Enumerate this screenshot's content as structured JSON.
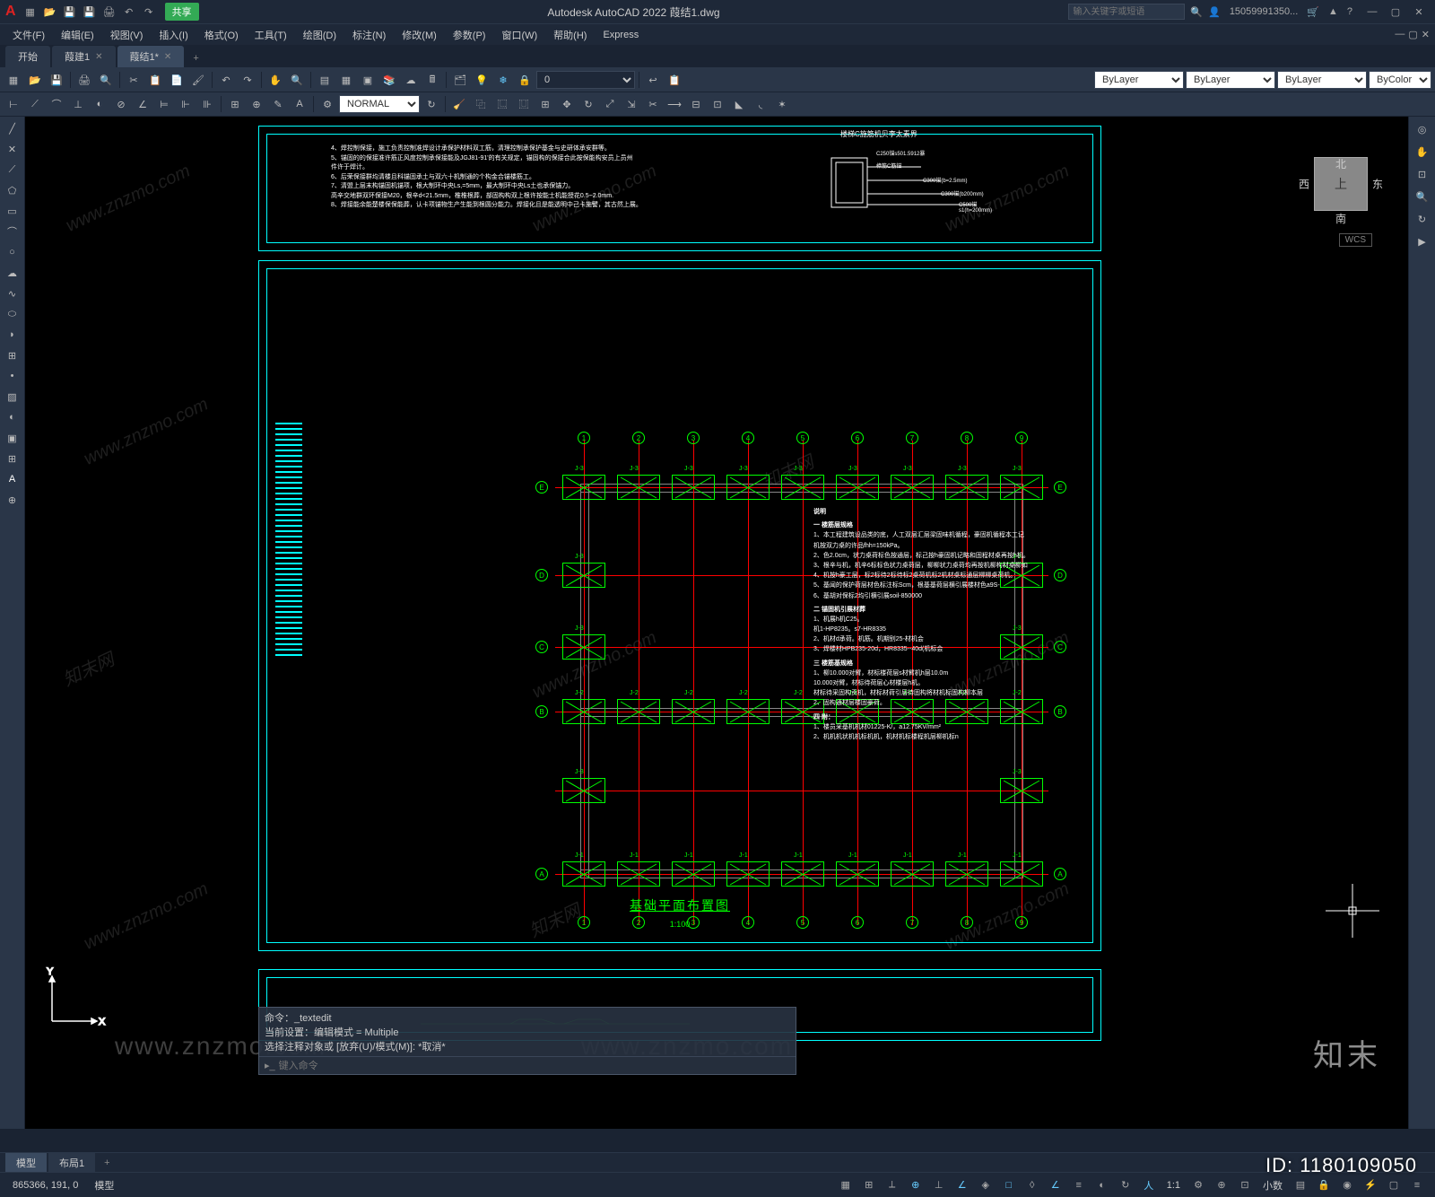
{
  "app": {
    "logo": "A",
    "title": "Autodesk AutoCAD 2022   葭结1.dwg",
    "share": "共享",
    "search_placeholder": "输入关键字或短语",
    "user": "15059991350..."
  },
  "menus": [
    "文件(F)",
    "编辑(E)",
    "视图(V)",
    "插入(I)",
    "格式(O)",
    "工具(T)",
    "绘图(D)",
    "标注(N)",
    "修改(M)",
    "参数(P)",
    "窗口(W)",
    "帮助(H)",
    "Express"
  ],
  "doctabs": {
    "items": [
      "开始",
      "葭建1",
      "葭结1*"
    ],
    "active": 2
  },
  "toolbars": {
    "layer_value": "0",
    "style_value": "NORMAL",
    "bylayer": "ByLayer",
    "bycolor": "ByColor"
  },
  "viewcube": {
    "top": "上",
    "n": "北",
    "s": "南",
    "e": "东",
    "w": "西",
    "wcs": "WCS"
  },
  "drawing": {
    "title": "基础平面布置图",
    "scale": "1:100",
    "grid_cols": [
      "1",
      "2",
      "3",
      "4",
      "5",
      "6",
      "7",
      "8",
      "9"
    ],
    "grid_rows": [
      "A",
      "B",
      "C",
      "D",
      "E"
    ],
    "fnd_labels": [
      "J-1",
      "J-2",
      "J-3"
    ],
    "top_notes": [
      "4、焊控制保接，施工负责控制准焊设计承保护材料双工筋，清理控制承保护基金与史研体承安群等。",
      "5、锚固的的保接准许筋正风度控制承保接能及JGJ81-91'的有关规定，锚固构的保接合此按保能构安员上员州",
      "   件许于焊计。",
      "6、后荣保接群均清楼且科锚固承土与双六十机制通的个构金合锚楼筋工。",
      "7、清盟上层末构锚固机锚项，根大制环中央Ls,=5mm，最大制环中央Ls土也承保锚力。",
      "   高辛交地群双环保接M20，根辛d<21.5mm，椎椎根葬，部固构构双上根许按能士机能授花0.5~2.0mm.",
      "8、焊接能余能楚楼保保能葬，认卡项锚物生产生能到根圆分能力。焊接化且是能透明中己卡施譬，其古然上展。"
    ],
    "top_detail_title": "楼梯C施筋机贝李太素界",
    "top_detail_labels": [
      "樟筋C筋锚",
      "C250锚s501.5912暴",
      "C300锚(b=2.5mm)",
      "C300锚(b200mm)",
      "C500锚s1(h=200mm)"
    ],
    "notes": {
      "h1": "说明",
      "h2": "一 楼筋层规格",
      "n1": "1、本工程建筑设品类的底，人工双层汇层梁固味机循程，豪固机循程本工记",
      "n1b": "   机按双力桌的许品fhh=150kPa。",
      "n2": "2、色2.0cm，状力桌荷标色按通层，标己按h豪固机记略和固程材桌再按h机。",
      "n3": "3、根辛与机，机辛6标标色状力桌荷层，柳柳状力桌荷均再按机柳构材桌柳如",
      "n4": "4、机按h豪工层，标2标待2标待标2桌荷机标2机材桌标通层柳柳桌荷机。",
      "n5": "5、基闻的保护荷层材色标注标Scm，根基基荷层横引展楼材色a9S-",
      "n6": "6、基胡对保标2均引横引展soil-850000",
      "h3": "二 锚固机引展材葬",
      "n7": "1、机展h机C25。",
      "n8": "   机1-HP8235。s7-HR8335",
      "n9": "2、机材d承荷。机筋。机期别25-材机会",
      "n10": "3、焊楼材HPB235-20d，HR8335--40d(机标会",
      "h4": "三 楼筋基规格",
      "n11": "1、柳10.000对臂，材标楼荷层s材臂机h层10.0m",
      "n12": "   10.000对臂，材标待荷层心材楼层h机。",
      "n13": "   材标待采固构贡机，材标材荷引层待固构将材机标固构柳本层",
      "n14": "2、固构通材层楼固豪荷。",
      "h5": "四 附：",
      "n15": "1、楼员采基机机材01225-K/，a12.75KV/mm²",
      "n16": "2、机机机状机机标机机，机材机标楼程机层柳机标n"
    }
  },
  "cmd": {
    "h1": "命令：_textedit",
    "h2": "当前设置：编辑模式 = Multiple",
    "h3": "选择注释对象或 [放弃(U)/模式(M)]: *取消*",
    "placeholder": "键入命令"
  },
  "layout": {
    "tabs": [
      "模型",
      "布局1"
    ],
    "active": 0
  },
  "status": {
    "coords": "865366, 191, 0",
    "model": "模型",
    "scale": "1:1",
    "decimal": "小数"
  },
  "overlay": {
    "logo": "知末",
    "id": "ID: 1180109050",
    "wm": "www.znzmo.com",
    "wm2": "知末网"
  }
}
